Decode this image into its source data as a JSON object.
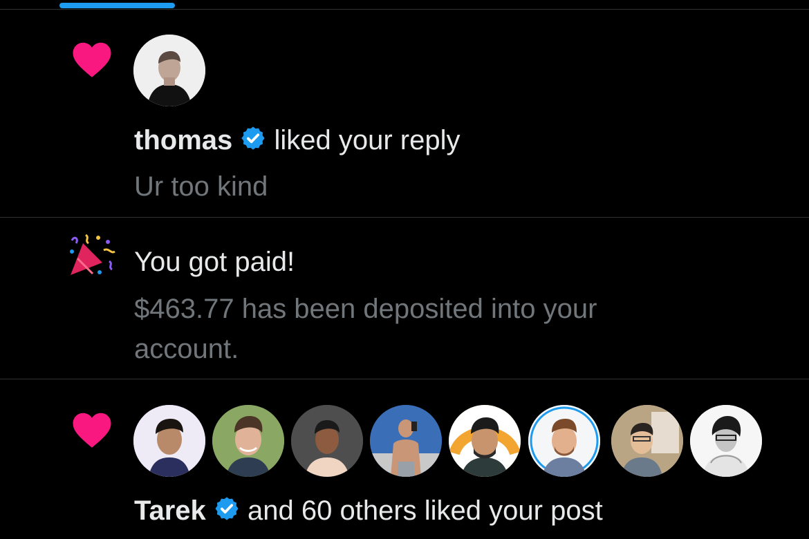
{
  "notifications": [
    {
      "type": "like",
      "actor": "thomas",
      "verified": true,
      "action": "liked your reply",
      "snippet": "Ur too kind"
    },
    {
      "type": "payout",
      "title": "You got paid!",
      "body_line1": "$463.77 has been deposited into your",
      "body_line2": "account."
    },
    {
      "type": "like-group",
      "actor": "Tarek",
      "verified": true,
      "action": "and 60 others liked your post",
      "avatar_count": 8
    }
  ],
  "colors": {
    "background": "#000000",
    "heart": "#f91880",
    "verified": "#1d9bf0",
    "secondary_text": "#71767b",
    "primary_text": "#e7e9ea",
    "tab_indicator": "#1d9bf0"
  },
  "icons": {
    "like": "heart-icon",
    "payout": "party-popper-icon",
    "verified": "verified-badge-icon"
  }
}
